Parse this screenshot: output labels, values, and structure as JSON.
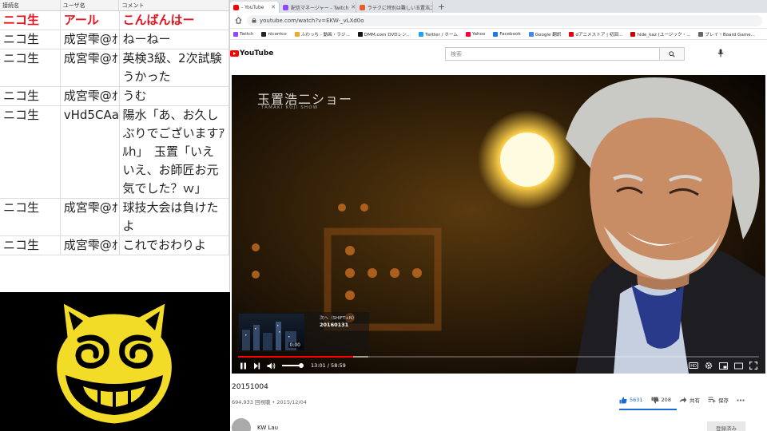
{
  "viewer": {
    "headers": [
      "接続名",
      "ユーザ名",
      "コメント"
    ],
    "rows": [
      {
        "connection": "ニコ生",
        "user": "アール",
        "comment": "こんばんはー"
      },
      {
        "connection": "ニコ生",
        "user": "成宮雫@ｵ",
        "comment": "ねーねー"
      },
      {
        "connection": "ニコ生",
        "user": "成宮雫@ｵ",
        "comment": "英検3級、2次試験うかった"
      },
      {
        "connection": "ニコ生",
        "user": "成宮雫@ｵ",
        "comment": "うむ"
      },
      {
        "connection": "ニコ生",
        "user": "vHd5CAa",
        "comment": "陽水「あ、お久しぶりでございますｱﾙh」　玉置「いえいえ、お師匠お元気でした？ｗ」"
      },
      {
        "connection": "ニコ生",
        "user": "成宮雫@ｵ",
        "comment": "球技大会は負けたよ"
      },
      {
        "connection": "ニコ生",
        "user": "成宮雫@ｵ",
        "comment": "これでおわりよ"
      }
    ]
  },
  "logo": {
    "icon": "grinning-cat-icon",
    "colors": {
      "face": "#f2dc28",
      "ink": "#000000"
    }
  },
  "browser": {
    "tabs": [
      {
        "label": "- YouTube",
        "icon": "youtube-icon",
        "active": true
      },
      {
        "label": "配信マネージャー - Twitch",
        "icon": "twitch-icon",
        "active": false
      },
      {
        "label": "ラテクに特別は難しい玉置浩二を歌",
        "icon": "page-icon",
        "active": false
      }
    ],
    "url": "youtube.com/watch?v=EKW-_vLXd0o",
    "bookmarks": [
      {
        "label": "Twitch",
        "color": "#9146ff"
      },
      {
        "label": "niconico",
        "color": "#252525"
      },
      {
        "label": "ふわっち - 動画・ラジ...",
        "color": "#f5a623"
      },
      {
        "label": "DMM.com DVDレン...",
        "color": "#111111"
      },
      {
        "label": "Twitter / ホーム",
        "color": "#1da1f2"
      },
      {
        "label": "Yahoo",
        "color": "#ff0033"
      },
      {
        "label": "Facebook",
        "color": "#1877f2"
      },
      {
        "label": "Google 翻訳",
        "color": "#4285f4"
      },
      {
        "label": "dアニメストア | 初回...",
        "color": "#e60012"
      },
      {
        "label": "hide_kaz (ユージック・...",
        "color": "#cc0000"
      },
      {
        "label": "ブレイ・Board Game...",
        "color": "#666666"
      }
    ]
  },
  "youtube": {
    "logo_text": "YouTube",
    "search_placeholder": "検索",
    "player": {
      "show_title": "玉置浩二ショー",
      "show_subtitle": "TAMAKI KOJI SHOW",
      "next_label": "次へ（SHIFT+N）",
      "next_title": "20160131",
      "next_time": "0:00",
      "time": "13:01 / 58:59",
      "progress_fraction": 0.2207
    },
    "title": "20151004",
    "meta": "694,933 回視聴 • 2015/12/04",
    "likes": "5631",
    "dislikes": "208",
    "share": "共有",
    "save": "保存",
    "channel": "KW Lau",
    "subscribe": "登録済み",
    "accent": "#1a6cd4"
  }
}
